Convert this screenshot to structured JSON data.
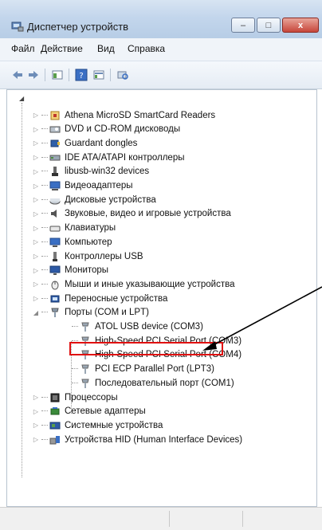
{
  "window": {
    "title": "Диспетчер устройств",
    "buttons": {
      "minimize": "–",
      "maximize": "□",
      "close": "x"
    }
  },
  "menu": [
    "Файл",
    "Действие",
    "Вид",
    "Справка"
  ],
  "toolbar_icons": [
    "back-arrow-icon",
    "forward-arrow-icon",
    "show-hide-icon",
    "help-icon",
    "properties-icon",
    "scan-hardware-icon"
  ],
  "tree": {
    "root_toggle": "◢",
    "categories": [
      {
        "label": "Athena MicroSD SmartCard Readers",
        "icon": "smartcard-reader-icon"
      },
      {
        "label": "DVD и CD-ROM дисководы",
        "icon": "dvd-drive-icon"
      },
      {
        "label": "Guardant dongles",
        "icon": "dongle-icon"
      },
      {
        "label": "IDE ATA/ATAPI контроллеры",
        "icon": "ide-controller-icon"
      },
      {
        "label": "libusb-win32 devices",
        "icon": "usb-plug-icon"
      },
      {
        "label": "Видеоадаптеры",
        "icon": "display-adapter-icon"
      },
      {
        "label": "Дисковые устройства",
        "icon": "disk-drive-icon"
      },
      {
        "label": "Звуковые, видео и игровые устройства",
        "icon": "speaker-icon"
      },
      {
        "label": "Клавиатуры",
        "icon": "keyboard-icon"
      },
      {
        "label": "Компьютер",
        "icon": "computer-icon"
      },
      {
        "label": "Контроллеры USB",
        "icon": "usb-controller-icon"
      },
      {
        "label": "Мониторы",
        "icon": "monitor-icon"
      },
      {
        "label": "Мыши и иные указывающие устройства",
        "icon": "mouse-icon"
      },
      {
        "label": "Переносные устройства",
        "icon": "portable-device-icon"
      },
      {
        "label": "Порты (COM и LPT)",
        "icon": "port-icon",
        "expanded": true,
        "children": [
          {
            "label": "ATOL USB device (COM3)",
            "icon": "port-device-icon",
            "highlighted": true
          },
          {
            "label": "High-Speed PCI Serial Port (COM3)",
            "icon": "port-device-icon"
          },
          {
            "label": "High-Speed PCI Serial Port (COM4)",
            "icon": "port-device-icon"
          },
          {
            "label": "PCI ECP Parallel Port (LPT3)",
            "icon": "port-device-icon"
          },
          {
            "label": "Последовательный порт (COM1)",
            "icon": "port-device-icon"
          }
        ]
      },
      {
        "label": "Процессоры",
        "icon": "processor-icon"
      },
      {
        "label": "Сетевые адаптеры",
        "icon": "network-adapter-icon"
      },
      {
        "label": "Системные устройства",
        "icon": "system-device-icon"
      },
      {
        "label": "Устройства HID (Human Interface Devices)",
        "icon": "hid-icon"
      }
    ]
  },
  "colors": {
    "highlight_box": "#e01010",
    "titlebar": "#c3d6ec",
    "arrow": "#000000"
  }
}
